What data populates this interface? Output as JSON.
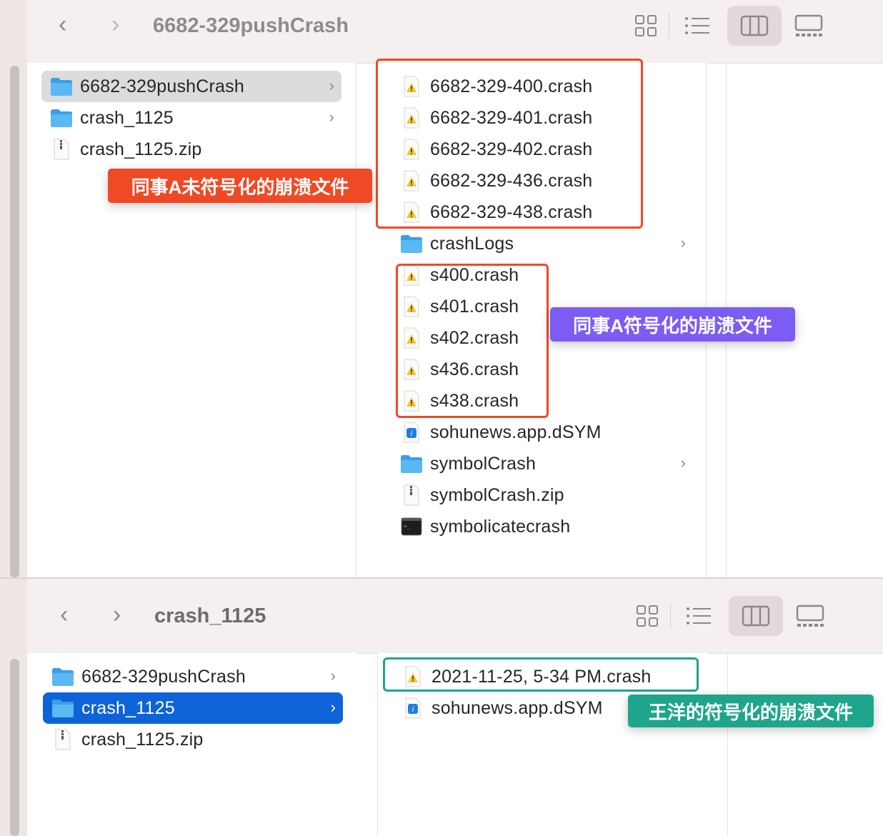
{
  "window_top": {
    "title": "6682-329pushCrash",
    "nav": {
      "back": "‹",
      "forward": "›"
    },
    "sidebar_items": [
      {
        "label": "6682-329pushCrash",
        "icon": "folder-icon",
        "chevron": "›"
      },
      {
        "label": "crash_1125",
        "icon": "folder-icon",
        "chevron": "›"
      },
      {
        "label": "crash_1125.zip",
        "icon": "zip-icon",
        "chevron": ""
      }
    ],
    "files": [
      {
        "label": "6682-329-400.crash",
        "icon": "crash-file-icon"
      },
      {
        "label": "6682-329-401.crash",
        "icon": "crash-file-icon"
      },
      {
        "label": "6682-329-402.crash",
        "icon": "crash-file-icon"
      },
      {
        "label": "6682-329-436.crash",
        "icon": "crash-file-icon"
      },
      {
        "label": "6682-329-438.crash",
        "icon": "crash-file-icon"
      },
      {
        "label": "crashLogs",
        "icon": "folder-icon",
        "chevron": "›"
      },
      {
        "label": "s400.crash",
        "icon": "crash-file-icon"
      },
      {
        "label": "s401.crash",
        "icon": "crash-file-icon"
      },
      {
        "label": "s402.crash",
        "icon": "crash-file-icon"
      },
      {
        "label": "s436.crash",
        "icon": "crash-file-icon"
      },
      {
        "label": "s438.crash",
        "icon": "crash-file-icon"
      },
      {
        "label": "sohunews.app.dSYM",
        "icon": "dsym-icon"
      },
      {
        "label": "symbolCrash",
        "icon": "folder-icon",
        "chevron": "›"
      },
      {
        "label": "symbolCrash.zip",
        "icon": "zip-icon"
      },
      {
        "label": "symbolicatecrash",
        "icon": "terminal-icon"
      }
    ],
    "annotations": {
      "unsymbolicated": "同事A未符号化的崩溃文件",
      "symbolicated": "同事A符号化的崩溃文件"
    }
  },
  "window_bottom": {
    "title": "crash_1125",
    "nav": {
      "back": "‹",
      "forward": "›"
    },
    "sidebar_items": [
      {
        "label": "6682-329pushCrash",
        "icon": "folder-icon",
        "chevron": "›"
      },
      {
        "label": "crash_1125",
        "icon": "folder-icon",
        "chevron": "›"
      },
      {
        "label": "crash_1125.zip",
        "icon": "zip-icon",
        "chevron": ""
      }
    ],
    "files": [
      {
        "label": "2021-11-25, 5-34 PM.crash",
        "icon": "crash-file-icon"
      },
      {
        "label": "sohunews.app.dSYM",
        "icon": "dsym-icon"
      }
    ],
    "annotations": {
      "wangyang": "王洋的符号化的崩溃文件"
    }
  },
  "colors": {
    "red_annotation": "#ef4a25",
    "purple_annotation": "#7c5cf2",
    "teal_annotation": "#1ea58b",
    "selection_blue": "#0f63d8",
    "folder_blue": "#5ab8f2"
  }
}
